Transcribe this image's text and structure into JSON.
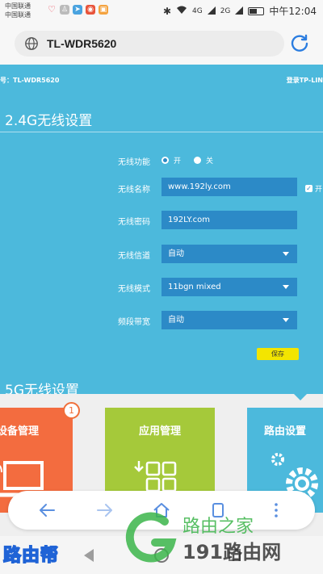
{
  "status_bar": {
    "carrier_1": "中国联通",
    "carrier_2": "中国联通",
    "network_1": "4G",
    "network_2": "2G",
    "time": "中午12:04"
  },
  "browser": {
    "address": "TL-WDR5620"
  },
  "page": {
    "model_label": "号：TL-WDR5620",
    "login_link": "登录TP-LIN",
    "section_24g": {
      "title": "2.4G无线设置",
      "wireless_function_label": "无线功能",
      "radio_on_label": "开",
      "radio_off_label": "关",
      "radio_on_selected": true,
      "ssid_label": "无线名称",
      "ssid_value": "www.192ly.com",
      "hide_checkbox_label": "开",
      "password_label": "无线密码",
      "password_value": "192LY.com",
      "channel_label": "无线信道",
      "channel_value": "自动",
      "mode_label": "无线模式",
      "mode_value": "11bgn mixed",
      "bandwidth_label": "频段带宽",
      "bandwidth_value": "自动",
      "save_label": "保存"
    },
    "section_5g": {
      "title": "5G无线设置"
    },
    "tiles": [
      {
        "label": "设备管理",
        "badge": "1",
        "color": "#f36c3f"
      },
      {
        "label": "应用管理",
        "color": "#a5c93a"
      },
      {
        "label": "路由设置",
        "color": "#4cb9dc"
      }
    ]
  },
  "watermarks": {
    "left": "路由帮",
    "right_top": "路由之家",
    "right_bottom": "191路由网"
  },
  "colors": {
    "page_bg": "#4cb9dc",
    "field_bg": "#2c8ac7",
    "save_button": "#f3e500",
    "nav_icon": "#5a8fe0"
  }
}
